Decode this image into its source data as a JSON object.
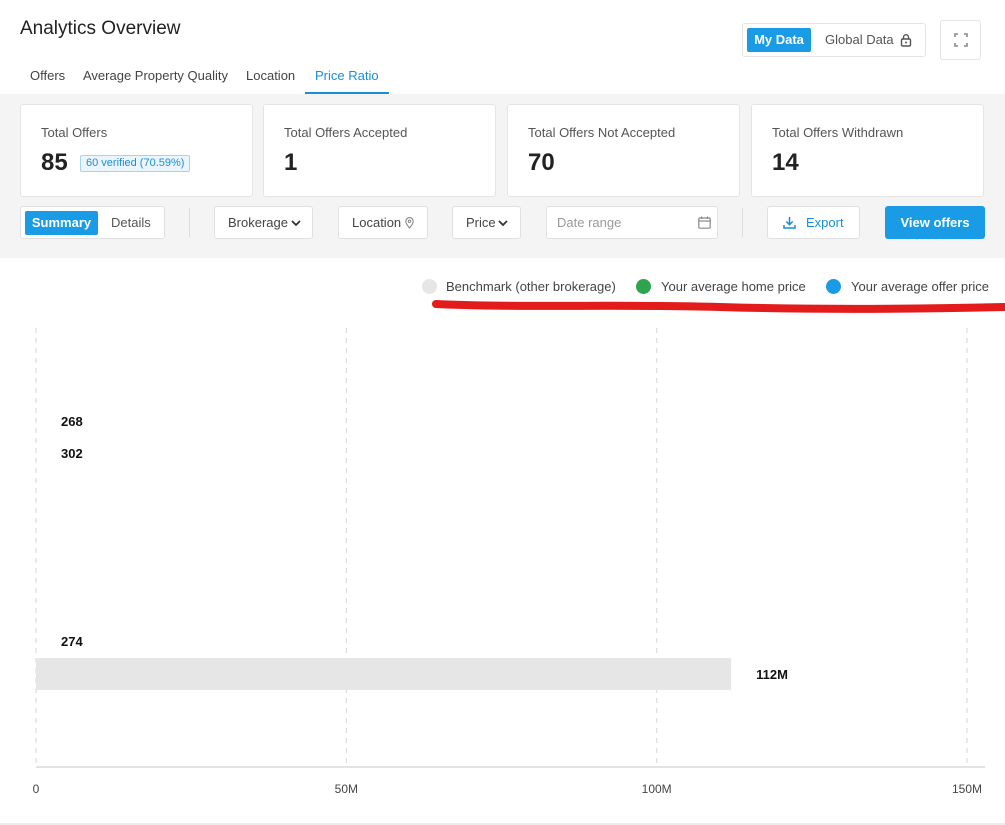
{
  "header": {
    "title": "Analytics Overview",
    "data_toggle": {
      "my_data": "My Data",
      "global_data": "Global Data"
    }
  },
  "tabs": [
    {
      "label": "Offers",
      "active": false
    },
    {
      "label": "Average Property Quality",
      "active": false
    },
    {
      "label": "Location",
      "active": false
    },
    {
      "label": "Price Ratio",
      "active": true
    }
  ],
  "cards": [
    {
      "label": "Total Offers",
      "value": "85",
      "badge": "60 verified (70.59%)"
    },
    {
      "label": "Total Offers Accepted",
      "value": "1"
    },
    {
      "label": "Total Offers Not Accepted",
      "value": "70"
    },
    {
      "label": "Total Offers Withdrawn",
      "value": "14"
    }
  ],
  "controls": {
    "view_toggle": {
      "summary": "Summary",
      "details": "Details",
      "selected": "Summary"
    },
    "brokerage": "Brokerage",
    "location": "Location",
    "price": "Price",
    "date_range_placeholder": "Date range",
    "export": "Export",
    "view_offers": "View offers"
  },
  "legend": [
    {
      "label": "Benchmark (other brokerage)",
      "color": "#e6e6e6"
    },
    {
      "label": "Your average home price",
      "color": "#2ea44f"
    },
    {
      "label": "Your average offer price",
      "color": "#1a9be6"
    }
  ],
  "chart_data": {
    "type": "bar",
    "orientation": "horizontal",
    "series": [
      {
        "name": "Benchmark (other brokerage)",
        "color": "#e6e6e6"
      },
      {
        "name": "Your average home price",
        "color": "#2ea44f"
      },
      {
        "name": "Your average offer price",
        "color": "#1a9be6"
      }
    ],
    "row_labels": [
      "268",
      "302",
      "274"
    ],
    "bars": [
      {
        "row": 2,
        "series": 0,
        "value": 112000000,
        "label": "112M"
      }
    ],
    "x_ticks": [
      {
        "value": 0,
        "label": "0"
      },
      {
        "value": 50000000,
        "label": "50M"
      },
      {
        "value": 100000000,
        "label": "100M"
      },
      {
        "value": 150000000,
        "label": "150M"
      }
    ],
    "xlim": [
      0,
      150000000
    ],
    "grid": true
  }
}
